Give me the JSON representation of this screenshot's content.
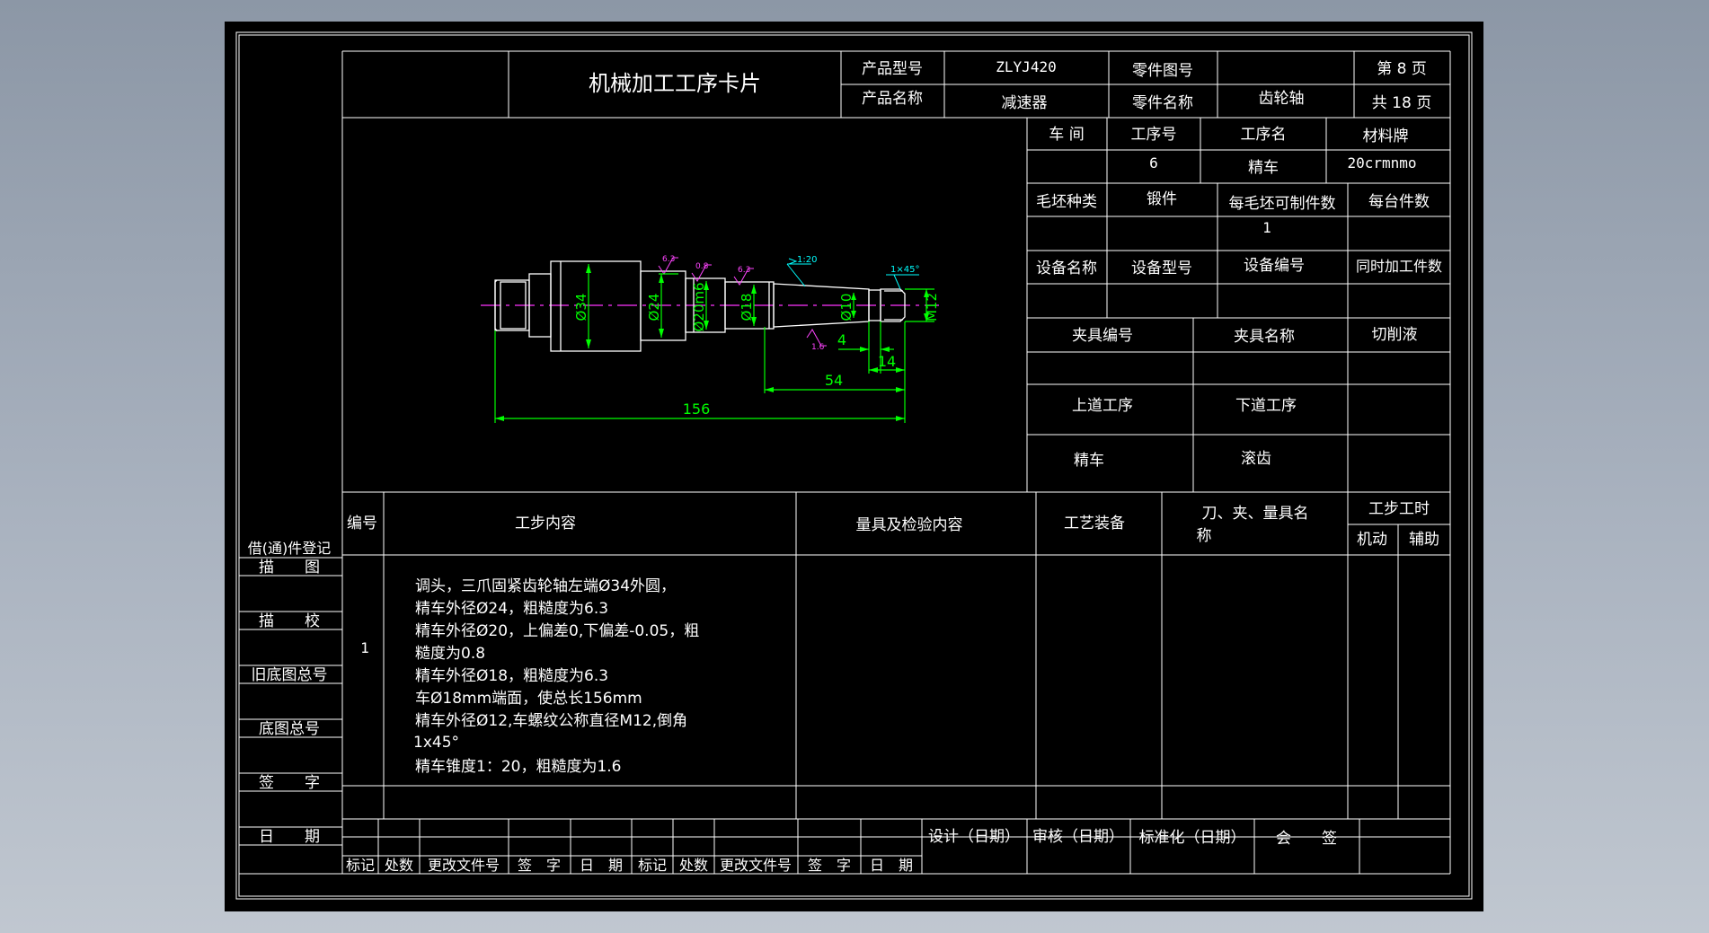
{
  "card": {
    "title": "机械加工工序卡片",
    "product_model_label": "产品型号",
    "product_model": "ZLYJ420",
    "product_name_label": "产品名称",
    "product_name": "减速器",
    "part_drawing_no_label": "零件图号",
    "part_drawing_no": "",
    "part_name_label": "零件名称",
    "part_name": "齿轮轴",
    "page_current": "第 8 页",
    "page_total": "共 18 页"
  },
  "info": {
    "workshop_label": "车 间",
    "process_no_label": "工序号",
    "process_name_label": "工序名",
    "material_label": "材料牌",
    "workshop": "",
    "process_no": "6",
    "process_name": "精车",
    "material": "20crmnmo",
    "blank_type_label": "毛坯种类",
    "blank_type": "锻件",
    "parts_per_blank_label": "每毛坯可制件数",
    "parts_per_blank": "1",
    "parts_per_unit_label": "每台件数",
    "equip_name_label": "设备名称",
    "equip_model_label": "设备型号",
    "equip_no_label": "设备编号",
    "simultaneous_label": "同时加工件数",
    "fixture_no_label": "夹具编号",
    "fixture_name_label": "夹具名称",
    "coolant_label": "切削液",
    "prev_op_label": "上道工序",
    "next_op_label": "下道工序",
    "prev_op": "精车",
    "next_op": "滚齿"
  },
  "drawing": {
    "dims": {
      "d34": "Ø34",
      "d24": "Ø24",
      "d20": "Ø20m6",
      "d18": "Ø18",
      "d10": "Ø10",
      "m12": "M12",
      "len156": "156",
      "len54": "54",
      "len14": "14",
      "len4": "4"
    },
    "roughness": [
      "6.3",
      "0.8",
      "6.3",
      "1.6"
    ],
    "taper": "1:20",
    "chamfer": "1×45°"
  },
  "steps_header": {
    "no": "编号",
    "content": "工步内容",
    "inspection": "量具及检验内容",
    "equipment": "工艺装备",
    "tools": "刀、夹、量具名",
    "tools2": "称",
    "step_time": "工步工时",
    "machine": "机动",
    "aux": "辅助"
  },
  "steps": [
    {
      "no": "1",
      "lines": [
        "调头，三爪固紧齿轮轴左端Ø34外圆，",
        "精车外径Ø24，粗糙度为6.3",
        "精车外径Ø20，上偏差0,下偏差-0.05，粗",
        "糙度为0.8",
        "精车外径Ø18，粗糙度为6.3",
        "车Ø18mm端面，使总长156mm",
        "精车外径Ø12,车螺纹公称直径M12,倒角",
        "1x45°",
        "精车锥度1：20，粗糙度为1.6"
      ]
    }
  ],
  "left_column": {
    "borrow_register": "借(通)件登记",
    "trace": "描　　图",
    "trace_check": "描　　校",
    "old_base_no": "旧底图总号",
    "base_no": "底图总号",
    "signature": "签　　字",
    "date": "日　　期"
  },
  "footer": {
    "design": "设计（日期）",
    "review": "审核（日期）",
    "standard": "标准化（日期）",
    "countersign": "会　　签",
    "cols": [
      "标记",
      "处数",
      "更改文件号",
      "签　字",
      "日　期",
      "标记",
      "处数",
      "更改文件号",
      "签　字",
      "日　期"
    ]
  }
}
